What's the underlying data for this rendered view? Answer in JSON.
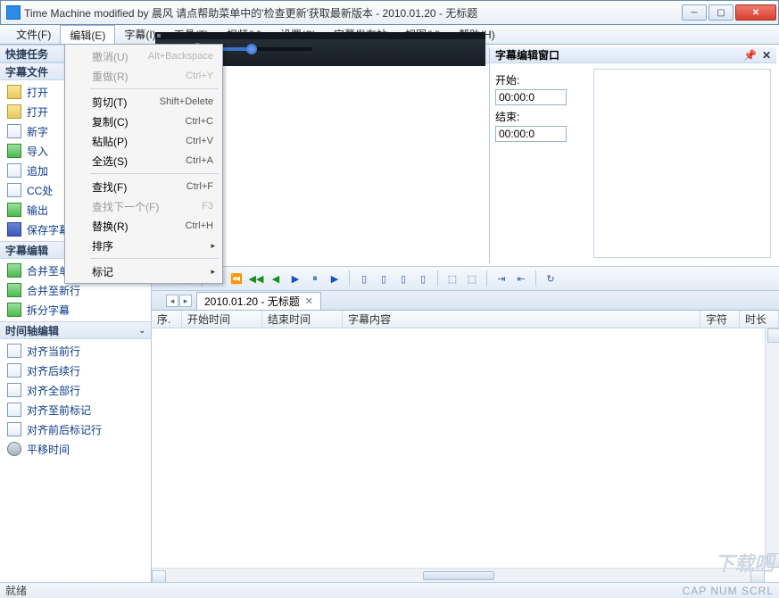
{
  "title": "Time Machine modified by 晨风 请点帮助菜单中的'检查更新'获取最新版本 - 2010.01.20 - 无标题",
  "menus": {
    "file": "文件(F)",
    "edit": "编辑(E)",
    "subtitle": "字幕(I)",
    "tools": "工具(T)",
    "video": "视频(V)",
    "settings": "设置(S)",
    "station": "字幕发布站",
    "view": "视图(V)",
    "help": "帮助(H)"
  },
  "edit_menu": {
    "undo": "撤消(U)",
    "undo_sc": "Alt+Backspace",
    "redo": "重做(R)",
    "redo_sc": "Ctrl+Y",
    "cut": "剪切(T)",
    "cut_sc": "Shift+Delete",
    "copy": "复制(C)",
    "copy_sc": "Ctrl+C",
    "paste": "粘贴(P)",
    "paste_sc": "Ctrl+V",
    "selectall": "全选(S)",
    "selectall_sc": "Ctrl+A",
    "find": "查找(F)",
    "find_sc": "Ctrl+F",
    "findnext": "查找下一个(F)",
    "findnext_sc": "F3",
    "replace": "替换(R)",
    "replace_sc": "Ctrl+H",
    "sort": "排序",
    "mark": "标记"
  },
  "quick_tasks_title": "快捷任务",
  "panels": {
    "subtitle_files": {
      "title": "字幕文件",
      "items": [
        "打开",
        "打开",
        "新字",
        "导入",
        "追加",
        "CC处",
        "输出",
        "保存字幕"
      ]
    },
    "subtitle_edit": {
      "title": "字幕编辑",
      "items": [
        "合并至单行尾部",
        "合并至新行",
        "拆分字幕"
      ]
    },
    "timeline_edit": {
      "title": "时间轴编辑",
      "items": [
        "对齐当前行",
        "对齐后续行",
        "对齐全部行",
        "对齐至前标记",
        "对齐前后标记行",
        "平移时间"
      ]
    }
  },
  "editor": {
    "title": "字幕编辑窗口",
    "start_label": "开始:",
    "start_value": "00:00:0",
    "end_label": "结束:",
    "end_value": "00:00:0"
  },
  "tab": {
    "label": "2010.01.20 - 无标题"
  },
  "grid_headers": {
    "seq": "序.",
    "start": "开始时间",
    "end": "结束时间",
    "content": "字幕内容",
    "chars": "字符",
    "dur": "时长"
  },
  "status": {
    "left": "就绪",
    "right": "CAP  NUM  SCRL"
  },
  "watermark": "下载吧"
}
